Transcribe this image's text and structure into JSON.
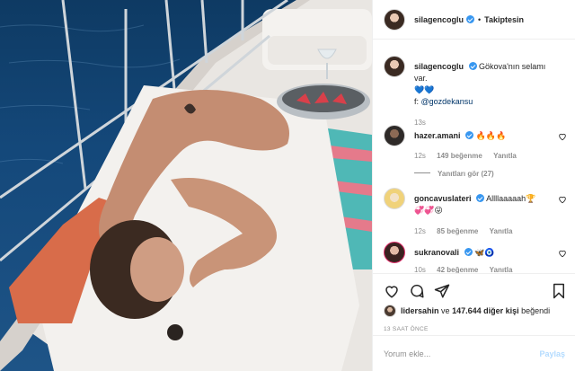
{
  "post": {
    "username": "silagencoglu",
    "follow_state": "Takiptesin",
    "separator": "•",
    "caption_text": "Gökova'nın selamı var.",
    "caption_emoji": "💙💙",
    "credit_prefix": "f:",
    "credit_mention": "@gozdekansu",
    "caption_time": "13s"
  },
  "comments": [
    {
      "username": "hazer.amani",
      "text": "🔥🔥🔥",
      "time": "12s",
      "likes": "149 beğenme",
      "reply": "Yanıtla",
      "view_replies": "Yanıtları gör (27)"
    },
    {
      "username": "goncavuslateri",
      "text": "Allllaaaaah🏆",
      "text2": "💞💞😜",
      "time": "12s",
      "likes": "85 beğenme",
      "reply": "Yanıtla"
    },
    {
      "username": "sukranovali",
      "text": "🦋🧿",
      "time": "10s",
      "likes": "42 beğenme",
      "reply": "Yanıtla"
    }
  ],
  "footer": {
    "liked_by_user": "lidersahin",
    "liked_conj": "ve",
    "liked_count": "147.644 diğer kişi",
    "liked_suffix": "beğendi",
    "timestamp": "13 SAAT ÖNCE",
    "comment_placeholder": "Yorum ekle...",
    "post_button": "Paylaş"
  },
  "icons": [
    "heart-icon",
    "comment-icon",
    "share-icon",
    "bookmark-icon"
  ],
  "colors": {
    "verified": "#3897f0",
    "link": "#003569",
    "muted": "#8e8e8e",
    "post_disabled": "#b3dbff"
  }
}
